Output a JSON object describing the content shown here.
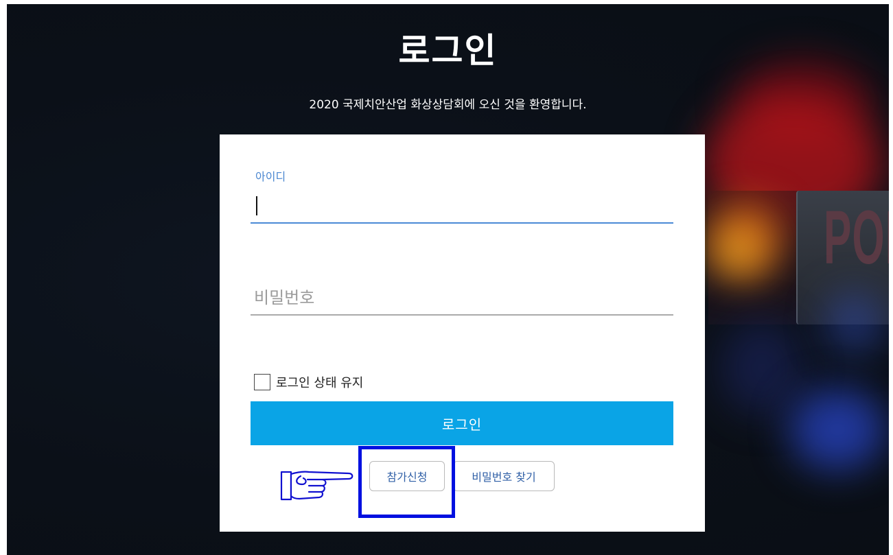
{
  "page": {
    "title": "로그인",
    "welcome": "2020 국제치안산업 화상상담회에 오신 것을 환영합니다."
  },
  "background": {
    "sign_text": "POI"
  },
  "form": {
    "id_label": "아이디",
    "id_value": "",
    "password_placeholder": "비밀번호",
    "password_value": "",
    "remember_label": "로그인 상태 유지",
    "remember_checked": false,
    "login_button": "로그인",
    "signup_button": "참가신청",
    "find_password_button": "비밀번호 찾기"
  },
  "annotation": {
    "pointer_icon": "pointing-hand-icon",
    "highlight_color": "#0010e0"
  },
  "colors": {
    "accent": "#0aa4e6",
    "focus_underline": "#4a8ad6",
    "link_text": "#2f5fa6"
  }
}
